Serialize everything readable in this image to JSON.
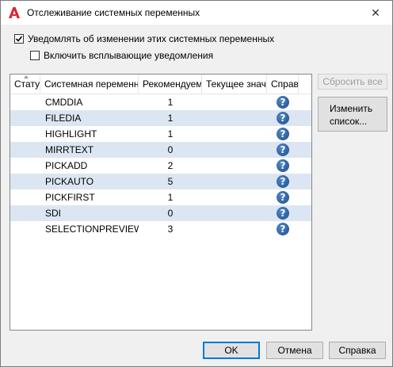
{
  "window": {
    "title": "Отслеживание системных переменных",
    "close_glyph": "✕"
  },
  "options": {
    "notify_label": "Уведомлять об изменении этих системных переменных",
    "notify_checked": true,
    "balloon_label": "Включить всплывающие уведомления",
    "balloon_checked": false
  },
  "table": {
    "columns": {
      "status": "Статус",
      "name": "Системная переменная",
      "recommended": "Рекомендуемое",
      "current": "Текущее значение",
      "help": "Справка"
    },
    "rows": [
      {
        "name": "CMDDIA",
        "recommended": "1"
      },
      {
        "name": "FILEDIA",
        "recommended": "1"
      },
      {
        "name": "HIGHLIGHT",
        "recommended": "1"
      },
      {
        "name": "MIRRTEXT",
        "recommended": "0"
      },
      {
        "name": "PICKADD",
        "recommended": "2"
      },
      {
        "name": "PICKAUTO",
        "recommended": "5"
      },
      {
        "name": "PICKFIRST",
        "recommended": "1"
      },
      {
        "name": "SDI",
        "recommended": "0"
      },
      {
        "name": "SELECTIONPREVIEW",
        "recommended": "3"
      }
    ],
    "help_glyph": "?"
  },
  "buttons": {
    "reset": "Сбросить все",
    "edit_line1": "Изменить",
    "edit_line2": "список...",
    "ok": "OK",
    "cancel": "Отмена",
    "help": "Справка"
  },
  "colors": {
    "row_alt": "#dce6f3",
    "default_border": "#0078d7",
    "app_icon": "#d9232d"
  }
}
